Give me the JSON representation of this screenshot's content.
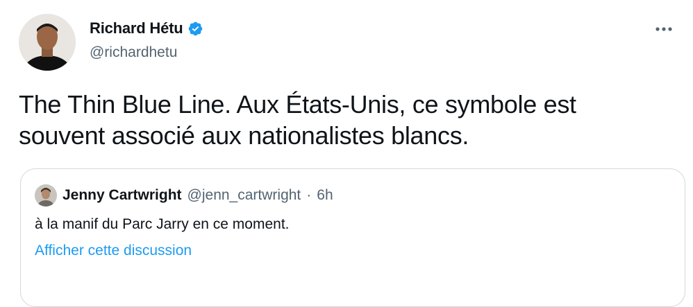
{
  "author": {
    "display_name": "Richard Hétu",
    "handle": "@richardhetu",
    "verified": true,
    "avatar_icon": "profile-photo"
  },
  "tweet": {
    "text_line1": "The Thin Blue Line. Aux États-Unis, ce symbole est",
    "text_line2": "souvent associé aux nationalistes blancs."
  },
  "more_icon": "more-horizontal-icon",
  "quoted_tweet": {
    "display_name": "Jenny Cartwright",
    "handle": "@jenn_cartwright",
    "separator": "·",
    "time": "6h",
    "text": "à la manif du Parc Jarry en ce moment.",
    "link_label": "Afficher cette discussion"
  },
  "colors": {
    "accent": "#1d9bf0",
    "text": "#0f1419",
    "secondary_text": "#536471",
    "border": "#cfd9de"
  }
}
